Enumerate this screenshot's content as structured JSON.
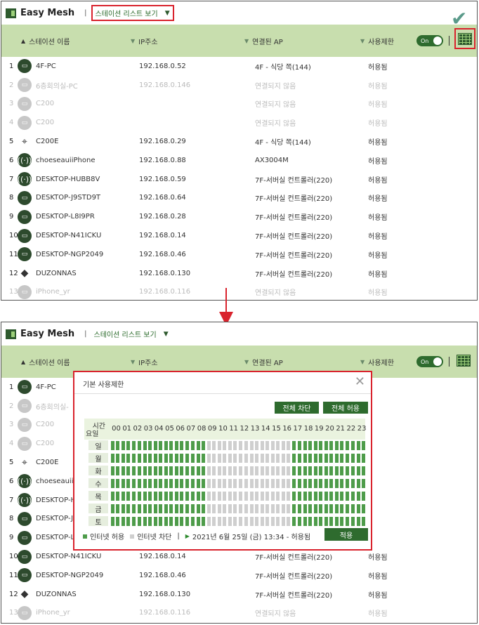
{
  "app": {
    "brand": "Easy Mesh",
    "view_label": "스테이션 리스트 보기"
  },
  "columns": {
    "station": "스테이션 이름",
    "ip": "IP주소",
    "ap": "연결된 AP",
    "limit": "사용제한"
  },
  "toggle_label": "On",
  "colors": {
    "header_bg": "#c8deae",
    "accent": "#2e6b2e",
    "allowed": "#4e9c4a",
    "blocked": "#cfcfcf",
    "highlight": "#d9232d"
  },
  "top_rows": [
    {
      "n": "1",
      "name": "4F-PC",
      "ip": "192.168.0.52",
      "ap": "4F - 식당 쪽(144)",
      "limit": "허용됨",
      "icon": "monitor",
      "dim": false
    },
    {
      "n": "2",
      "name": "6층회의실-PC",
      "ip": "192.168.0.146",
      "ap": "연결되지 않음",
      "limit": "허용됨",
      "icon": "monitor",
      "dim": true
    },
    {
      "n": "3",
      "name": "C200",
      "ip": "",
      "ap": "연결되지 않음",
      "limit": "허용됨",
      "icon": "monitor",
      "dim": true
    },
    {
      "n": "4",
      "name": "C200",
      "ip": "",
      "ap": "연결되지 않음",
      "limit": "허용됨",
      "icon": "monitor",
      "dim": true
    },
    {
      "n": "5",
      "name": "C200E",
      "ip": "192.168.0.29",
      "ap": "4F - 식당 쪽(144)",
      "limit": "허용됨",
      "icon": "camera",
      "dim": false
    },
    {
      "n": "6",
      "name": "choeseauiiPhone",
      "ip": "192.168.0.88",
      "ap": "AX3004M",
      "limit": "허용됨",
      "icon": "wifi",
      "dim": false
    },
    {
      "n": "7",
      "name": "DESKTOP-HUBB8V",
      "ip": "192.168.0.59",
      "ap": "7F-서버실 컨트롤러(220)",
      "limit": "허용됨",
      "icon": "wifi",
      "dim": false
    },
    {
      "n": "8",
      "name": "DESKTOP-J9STD9T",
      "ip": "192.168.0.64",
      "ap": "7F-서버실 컨트롤러(220)",
      "limit": "허용됨",
      "icon": "monitor",
      "dim": false
    },
    {
      "n": "9",
      "name": "DESKTOP-L8I9PR",
      "ip": "192.168.0.28",
      "ap": "7F-서버실 컨트롤러(220)",
      "limit": "허용됨",
      "icon": "monitor",
      "dim": false
    },
    {
      "n": "10",
      "name": "DESKTOP-N41ICKU",
      "ip": "192.168.0.14",
      "ap": "7F-서버실 컨트롤러(220)",
      "limit": "허용됨",
      "icon": "monitor",
      "dim": false
    },
    {
      "n": "11",
      "name": "DESKTOP-NGP2049",
      "ip": "192.168.0.46",
      "ap": "7F-서버실 컨트롤러(220)",
      "limit": "허용됨",
      "icon": "monitor",
      "dim": false
    },
    {
      "n": "12",
      "name": "DUZONNAS",
      "ip": "192.168.0.130",
      "ap": "7F-서버실 컨트롤러(220)",
      "limit": "허용됨",
      "icon": "nas",
      "dim": false
    },
    {
      "n": "13",
      "name": "iPhone_yr",
      "ip": "192.168.0.116",
      "ap": "연결되지 않음",
      "limit": "허용됨",
      "icon": "monitor",
      "dim": true
    }
  ],
  "bottom_rows": [
    {
      "n": "1",
      "name": "4F-PC",
      "ip": "",
      "ap": "",
      "limit": "",
      "icon": "monitor",
      "dim": false
    },
    {
      "n": "2",
      "name": "6층회의실-",
      "ip": "",
      "ap": "",
      "limit": "",
      "icon": "monitor",
      "dim": true
    },
    {
      "n": "3",
      "name": "C200",
      "ip": "",
      "ap": "",
      "limit": "",
      "icon": "monitor",
      "dim": true
    },
    {
      "n": "4",
      "name": "C200",
      "ip": "",
      "ap": "",
      "limit": "",
      "icon": "monitor",
      "dim": true
    },
    {
      "n": "5",
      "name": "C200E",
      "ip": "",
      "ap": "",
      "limit": "",
      "icon": "camera",
      "dim": false
    },
    {
      "n": "6",
      "name": "choeseauiiP",
      "ip": "",
      "ap": "",
      "limit": "",
      "icon": "wifi",
      "dim": false
    },
    {
      "n": "7",
      "name": "DESKTOP-H",
      "ip": "",
      "ap": "",
      "limit": "",
      "icon": "wifi",
      "dim": false
    },
    {
      "n": "8",
      "name": "DESKTOP-J9",
      "ip": "",
      "ap": "",
      "limit": "",
      "icon": "monitor",
      "dim": false
    },
    {
      "n": "9",
      "name": "DESKTOP-L",
      "ip": "",
      "ap": "",
      "limit": "",
      "icon": "monitor",
      "dim": false
    },
    {
      "n": "10",
      "name": "DESKTOP-N41ICKU",
      "ip": "192.168.0.14",
      "ap": "7F-서버실 컨트롤러(220)",
      "limit": "허용됨",
      "icon": "monitor",
      "dim": false
    },
    {
      "n": "11",
      "name": "DESKTOP-NGP2049",
      "ip": "192.168.0.46",
      "ap": "7F-서버실 컨트롤러(220)",
      "limit": "허용됨",
      "icon": "monitor",
      "dim": false
    },
    {
      "n": "12",
      "name": "DUZONNAS",
      "ip": "192.168.0.130",
      "ap": "7F-서버실 컨트롤러(220)",
      "limit": "허용됨",
      "icon": "nas",
      "dim": false
    },
    {
      "n": "13",
      "name": "iPhone_yr",
      "ip": "192.168.0.116",
      "ap": "연결되지 않음",
      "limit": "허용됨",
      "icon": "monitor",
      "dim": true
    }
  ],
  "modal": {
    "title": "기본 사용제한",
    "close": "✕",
    "block_all": "전체 차단",
    "allow_all": "전체 허용",
    "corner_time": "시간",
    "corner_day": "요일",
    "hours": [
      "00",
      "01",
      "02",
      "03",
      "04",
      "05",
      "06",
      "07",
      "08",
      "09",
      "10",
      "11",
      "12",
      "13",
      "14",
      "15",
      "16",
      "17",
      "18",
      "19",
      "20",
      "21",
      "22",
      "23"
    ],
    "days": [
      "일",
      "월",
      "화",
      "수",
      "목",
      "금",
      "토"
    ],
    "blocked_from_hour": 9,
    "blocked_to_hour": 16,
    "legend_allow": "인터넷 허용",
    "legend_block": "인터넷 차단",
    "status_text": "2021년 6월 25일 (금) 13:34 - 허용됨",
    "apply": "적용"
  }
}
